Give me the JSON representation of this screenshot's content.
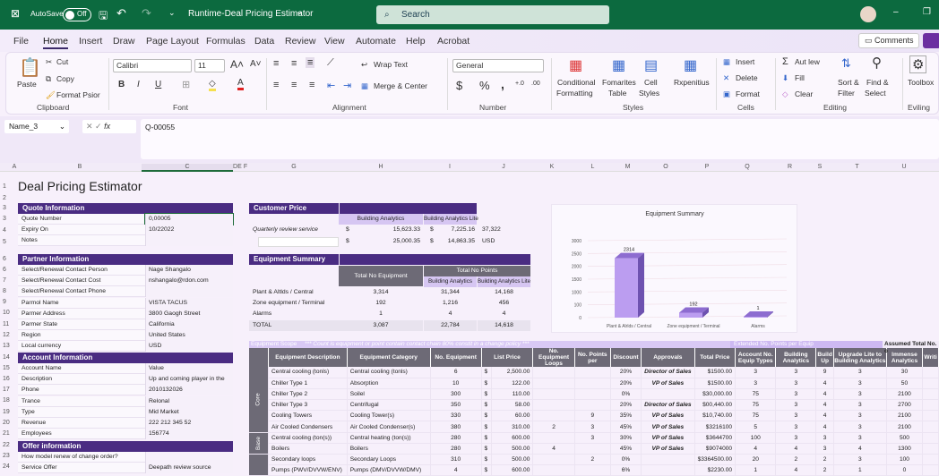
{
  "titlebar": {
    "autosave": "AutoSave",
    "toggle": "Off",
    "title": "Runtime-Deal Pricing Estimator",
    "search": "Search"
  },
  "tabs": [
    "File",
    "Home",
    "Insert",
    "Draw",
    "Page Layout",
    "Formulas",
    "Data",
    "Review",
    "View",
    "Automate",
    "Help",
    "Acrobat"
  ],
  "comments": "Comments",
  "ribbon": {
    "paste": "Paste",
    "cut": "Cut",
    "copy": "Copy",
    "format_painter": "Format Psior",
    "clipboard": "Clipboard",
    "font_name": "Calibri",
    "font_size": "11",
    "font": "Font",
    "bold": "B",
    "italic": "I",
    "underline": "U",
    "wrap_text": "Wrap Text",
    "merge_center": "Merge & Center",
    "alignment": "Alignment",
    "number_format": "General",
    "number": "Number",
    "currency": "$",
    "percent": "%",
    "comma": ",",
    "conditional": "Conditional",
    "formatting": "Formatting",
    "format_as": "Fomarites",
    "table": "Table",
    "cell": "Cell",
    "styles_btn": "Styles",
    "styles": "Styles",
    "rxpenitius": "Rxpenitius",
    "insert": "Insert",
    "delete": "Delete",
    "format": "Format",
    "cells": "Cells",
    "autosum": "Aut lew",
    "fill": "Fill",
    "clear": "Clear",
    "sort": "Sort &",
    "filter": "Filter",
    "find": "Find &",
    "select": "Select",
    "editing": "Editing",
    "toolbox": "Toolbox",
    "eviling": "Eviling"
  },
  "formula_bar": {
    "name_box": "Name_3",
    "fx": "fx",
    "value": "Q-00055"
  },
  "columns": [
    "A",
    "B",
    "C",
    "D",
    "E",
    "F",
    "G",
    "H",
    "I",
    "J",
    "K",
    "L",
    "M",
    "O",
    "P",
    "Q",
    "R",
    "S",
    "T",
    "U"
  ],
  "rows": [
    "1",
    "2",
    "3",
    "3",
    "4",
    "5",
    "6",
    "6",
    "7",
    "8",
    "9",
    "10",
    "11",
    "12",
    "13",
    "14",
    "15",
    "16",
    "17",
    "18",
    "19",
    "20",
    "21",
    "22",
    "23",
    "24"
  ],
  "sheet_title": "Deal Pricing Estimator",
  "info_sections": [
    {
      "title": "Quote Information",
      "rows": [
        [
          "Quote Number",
          "0,00005"
        ],
        [
          "Expiry On",
          "10/22022"
        ],
        [
          "Notes",
          ""
        ]
      ]
    },
    {
      "title": "Partner Information",
      "rows": [
        [
          "Select/Renewal Contact Person",
          "Nage Shangalo"
        ],
        [
          "Select/Renewal Contact Cost",
          "nshangalo@rdon.com"
        ],
        [
          "Select/Renewal Contact Phone",
          ""
        ],
        [
          "Parmol Name",
          "VISTA TACUS"
        ],
        [
          "Parmer Address",
          "3800 Gaogh Street"
        ],
        [
          "Parmer State",
          "California"
        ],
        [
          "Region",
          "United States"
        ],
        [
          "Local currency",
          "USD"
        ]
      ]
    },
    {
      "title": "Account Information",
      "rows": [
        [
          "Account Name",
          "Value"
        ],
        [
          "Description",
          "Up and coming player in the space"
        ],
        [
          "Phone",
          "2010132026"
        ],
        [
          "Trance",
          "Relonal"
        ],
        [
          "Type",
          "Mid Market"
        ],
        [
          "Revenue",
          "222 212 345 52"
        ],
        [
          "Employees",
          "156774"
        ]
      ]
    },
    {
      "title": "Offer information",
      "rows": [
        [
          "How model renew of change order?",
          ""
        ],
        [
          "Service Offer",
          "Deepath review source"
        ]
      ]
    }
  ],
  "customer_price": {
    "title": "Customer Price",
    "col1": "Building Analytics",
    "col2": "Building Analytics Lite",
    "row1_label": "Quarterly review service",
    "currency": "$",
    "r1v1": "15,623.33",
    "r1v2": "7,225.16",
    "r1extra": "37,322",
    "r2v1": "25,000.35",
    "r2v2": "14,863.35",
    "r2extra": "USD"
  },
  "equipment_summary": {
    "title": "Equipment Summary",
    "h_total_equipment": "Total No Equipment",
    "h_total_points": "Total No Points",
    "h_ba": "Building Analytics",
    "h_bal": "Building Analytics Lite",
    "rows": [
      [
        "Plant & Altlds / Central",
        "3,314",
        "31,344",
        "14,168"
      ],
      [
        "Zone equipment / Terminal",
        "192",
        "1,216",
        "456"
      ],
      [
        "Alarms",
        "1",
        "4",
        "4"
      ],
      [
        "TOTAL",
        "3,087",
        "22,784",
        "14,618"
      ]
    ]
  },
  "chart_data": {
    "type": "bar",
    "title": "Equipment Summary",
    "categories": [
      "Plant & Alrlds / Central",
      "Zone equipment / Terminal",
      "Alarms"
    ],
    "values": [
      2314,
      192,
      1
    ],
    "value_labels": [
      "2314",
      "192",
      "1"
    ],
    "ytick_labels": [
      "0",
      "100",
      "1000",
      "1500",
      "2000",
      "2500",
      "3000"
    ],
    "ylim": [
      0,
      3000
    ],
    "xlabel": "",
    "ylabel": "",
    "grid": true
  },
  "scope": {
    "title": "Equipment Scope",
    "note": "*** Count is equipment or point contain contact chain 80% constit in a change policy ***",
    "ext_title": "Extended No. Points per Equip",
    "assumed_title": "Assumed Total No. o",
    "headers": [
      "Equipment Description",
      "Equipment Category",
      "No. Equipment",
      "List Price",
      "No. Equipment Loops",
      "No. Points per",
      "Discount",
      "Approvals",
      "Total Price",
      "Account No. Equip Types",
      "Building Analytics",
      "Build Up",
      "Upgrade Lite to Building Analytics",
      "Immense Analytics",
      "Writi"
    ],
    "groups": [
      {
        "label": "Core",
        "span": 6
      },
      {
        "label": "Base",
        "span": 2
      },
      {
        "label": "",
        "span": 2
      }
    ],
    "rows": [
      [
        "Central cooling (tonls)",
        "Central cooling (tonls)",
        "6",
        "$",
        "2,500.00",
        "",
        "",
        "20%",
        "Director of Sales",
        "$1500.00",
        "3",
        "3",
        "9",
        "3",
        "30",
        ""
      ],
      [
        "Chiller Type 1",
        "Absorption",
        "10",
        "$",
        "122.00",
        "",
        "",
        "20%",
        "VP of Sales",
        "$1500.00",
        "3",
        "3",
        "4",
        "3",
        "50",
        ""
      ],
      [
        "Chiller Type 2",
        "Soilel",
        "300",
        "$",
        "110.00",
        "",
        "",
        "0%",
        "",
        "$30,000.00",
        "75",
        "3",
        "4",
        "3",
        "2100",
        ""
      ],
      [
        "Chiller Type 3",
        "Centrifugal",
        "350",
        "$",
        "58.00",
        "",
        "",
        "20%",
        "Director of Sales",
        "$00,440.00",
        "75",
        "3",
        "4",
        "3",
        "2700",
        ""
      ],
      [
        "Cooling Towers",
        "Cooling Tower(s)",
        "330",
        "$",
        "60.00",
        "",
        "9",
        "35%",
        "VP of Sales",
        "$10,740.00",
        "75",
        "3",
        "4",
        "3",
        "2100",
        ""
      ],
      [
        "Air Cooled Condensers",
        "Air Cooled Condenser(s)",
        "380",
        "$",
        "310.00",
        "2",
        "3",
        "45%",
        "VP of Sales",
        "$3216100",
        "5",
        "3",
        "4",
        "3",
        "2100",
        ""
      ],
      [
        "Central cooling (ton(s))",
        "Central heating (ton(s))",
        "280",
        "$",
        "600.00",
        "",
        "3",
        "30%",
        "VP of Sales",
        "$3644700",
        "100",
        "3",
        "3",
        "3",
        "500",
        ""
      ],
      [
        "Boilers",
        "Boilers",
        "280",
        "$",
        "500.00",
        "4",
        "",
        "45%",
        "VP of Sales",
        "$9074000",
        "4",
        "4",
        "3",
        "4",
        "1300",
        ""
      ],
      [
        "Secondary loops",
        "Secondary Loops",
        "310",
        "$",
        "500.00",
        "",
        "2",
        "0%",
        "",
        "$3364500.00",
        "20",
        "2",
        "2",
        "3",
        "100",
        ""
      ],
      [
        "Pumps (PWV/DVVW/ENV)",
        "Pumps (DMV/DVVW/DMV)",
        "4",
        "$",
        "600.00",
        "",
        "",
        "6%",
        "",
        "$2230.00",
        "1",
        "4",
        "2",
        "1",
        "0",
        ""
      ]
    ]
  },
  "colors": {
    "titlebar": "#0c6a3f",
    "section": "#4a2c82",
    "lavender": "#d6c6f2",
    "gray_header": "#6d6a76",
    "bar": "#b497ee"
  }
}
